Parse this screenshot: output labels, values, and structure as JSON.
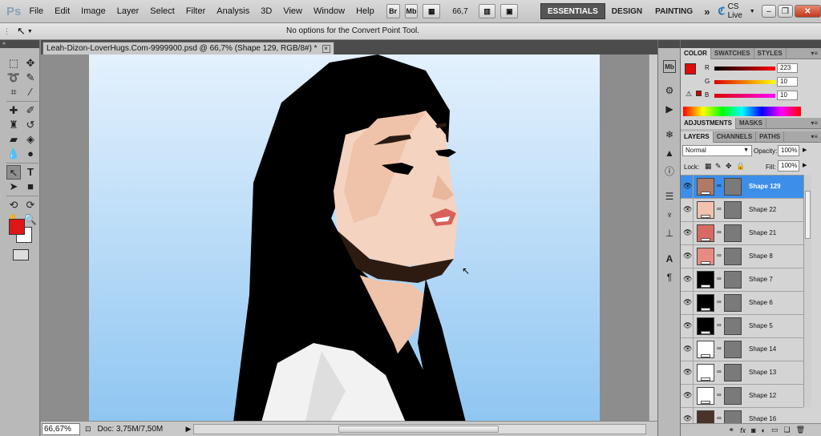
{
  "app": {
    "logo": "Ps",
    "menus": [
      "File",
      "Edit",
      "Image",
      "Layer",
      "Select",
      "Filter",
      "Analysis",
      "3D",
      "View",
      "Window",
      "Help"
    ],
    "toolbar": {
      "br": "Br",
      "mb": "Mb",
      "zoom": "66,7"
    },
    "workspaces": {
      "essentials": "ESSENTIALS",
      "design": "DESIGN",
      "painting": "PAINTING",
      "more": "»"
    },
    "cs_live": "CS Live",
    "window_controls": {
      "minimize": "–",
      "restore": "❐",
      "close": "✕"
    }
  },
  "options_bar": {
    "text": "No options for the Convert Point Tool."
  },
  "document": {
    "tab_title": "Leah-Dizon-LoverHugs.Com-9999900.psd @ 66,7% (Shape 129, RGB/8#) *",
    "close": "×",
    "status_zoom": "66,67%",
    "doc_info": "Doc: 3,75M/7,50M",
    "canvas_gradient": {
      "top": "#e4f1fd",
      "bottom": "#8fc6f2"
    }
  },
  "color_panel": {
    "tabs": [
      "COLOR",
      "SWATCHES",
      "STYLES"
    ],
    "channels": [
      {
        "label": "R",
        "value": "223"
      },
      {
        "label": "G",
        "value": "10"
      },
      {
        "label": "B",
        "value": "10"
      }
    ],
    "foreground": "#df0a0a"
  },
  "adjustments_tabs": [
    "ADJUSTMENTS",
    "MASKS"
  ],
  "layers_panel": {
    "tabs": [
      "LAYERS",
      "CHANNELS",
      "PATHS"
    ],
    "blend_mode": "Normal",
    "opacity_label": "Opacity:",
    "opacity": "100%",
    "lock_label": "Lock:",
    "fill_label": "Fill:",
    "fill": "100%",
    "layers": [
      {
        "name": "Shape 129",
        "color": "#b07a64",
        "selected": true
      },
      {
        "name": "Shape 22",
        "color": "#f1c2ad",
        "selected": false
      },
      {
        "name": "Shape 21",
        "color": "#d96a63",
        "selected": false
      },
      {
        "name": "Shape 8",
        "color": "#e98b83",
        "selected": false
      },
      {
        "name": "Shape 7",
        "color": "#000000",
        "selected": false
      },
      {
        "name": "Shape 6",
        "color": "#000000",
        "selected": false
      },
      {
        "name": "Shape 5",
        "color": "#000000",
        "selected": false
      },
      {
        "name": "Shape 14",
        "color": "#ffffff",
        "selected": false
      },
      {
        "name": "Shape 13",
        "color": "#ffffff",
        "selected": false
      },
      {
        "name": "Shape 12",
        "color": "#ffffff",
        "selected": false
      },
      {
        "name": "Shape 16",
        "color": "#4a3328",
        "selected": false
      }
    ]
  }
}
